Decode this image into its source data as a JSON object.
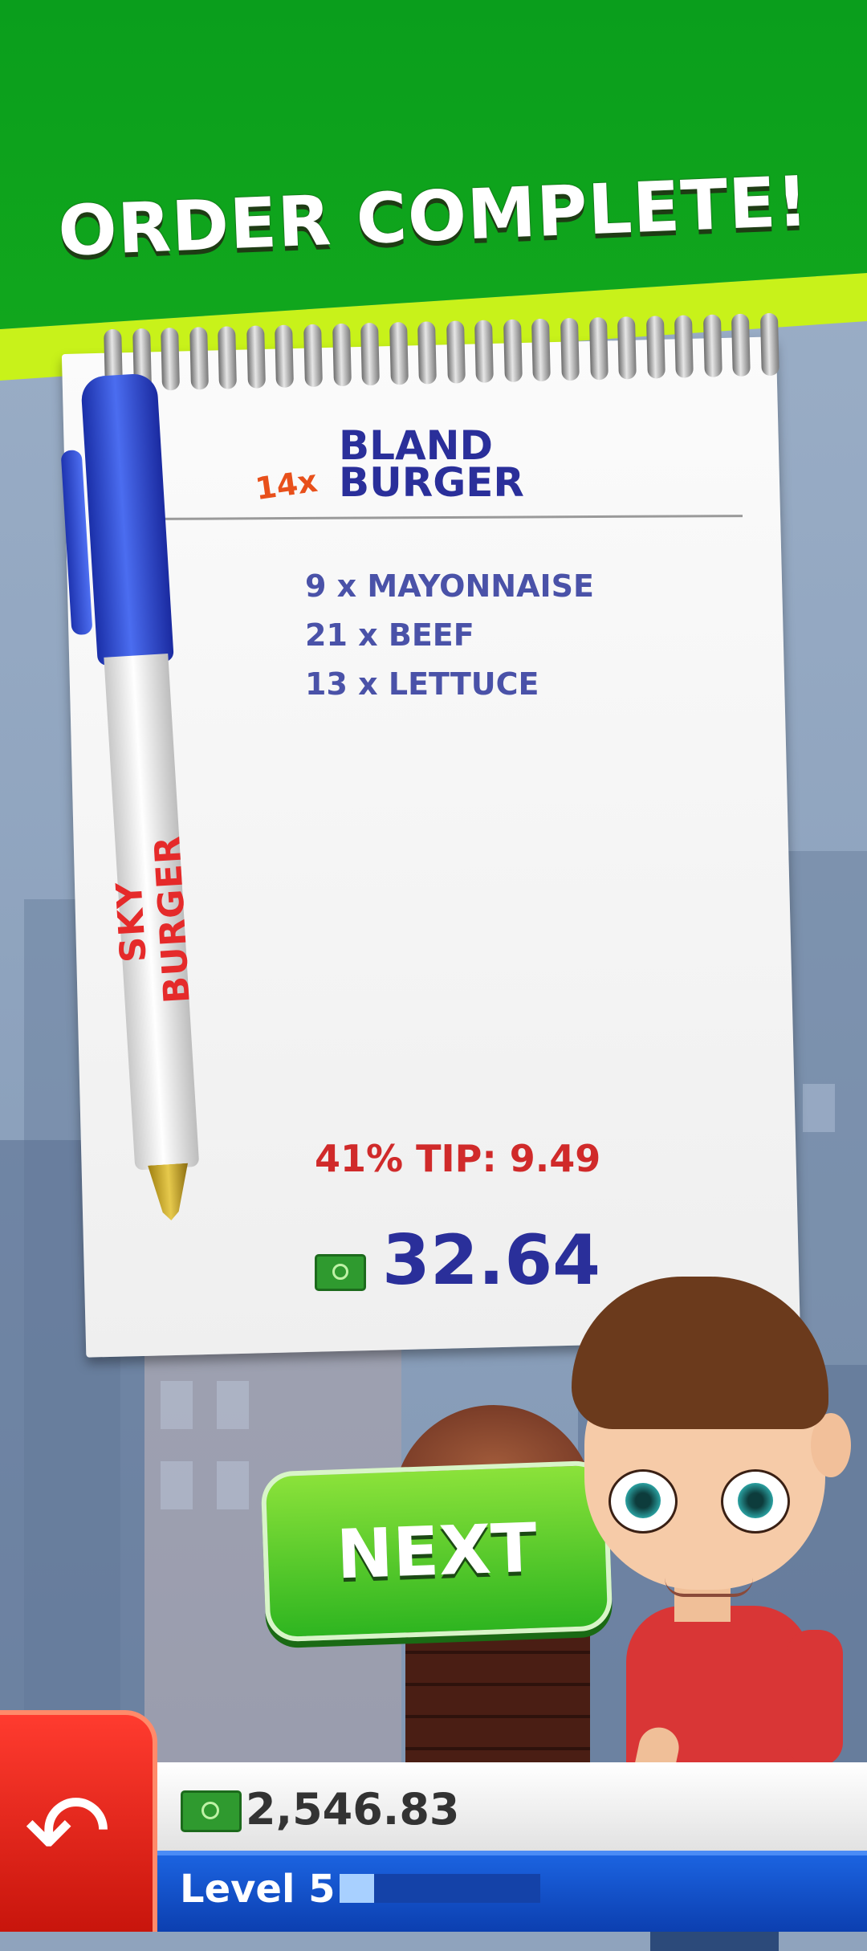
{
  "banner": {
    "title": "ORDER COMPLETE!"
  },
  "order": {
    "quantity": "14x",
    "name": "BLAND BURGER",
    "ingredients": [
      "9 x MAYONNAISE",
      "21 x BEEF",
      "13 x LETTUCE"
    ],
    "tip": "41% TIP: 9.49",
    "total": "32.64"
  },
  "pen": {
    "brand": "SKY BURGER"
  },
  "next_button": {
    "label": "NEXT"
  },
  "status": {
    "money": "2,546.83",
    "level": "Level 5",
    "level_progress": 0.17
  },
  "icons": {
    "money": "cash-icon",
    "back": "back-arrow-icon"
  },
  "colors": {
    "banner": "#12a81d",
    "accent": "#c8f21a",
    "next": "#3fc420",
    "back": "#e0231a",
    "level": "#1250c8"
  }
}
